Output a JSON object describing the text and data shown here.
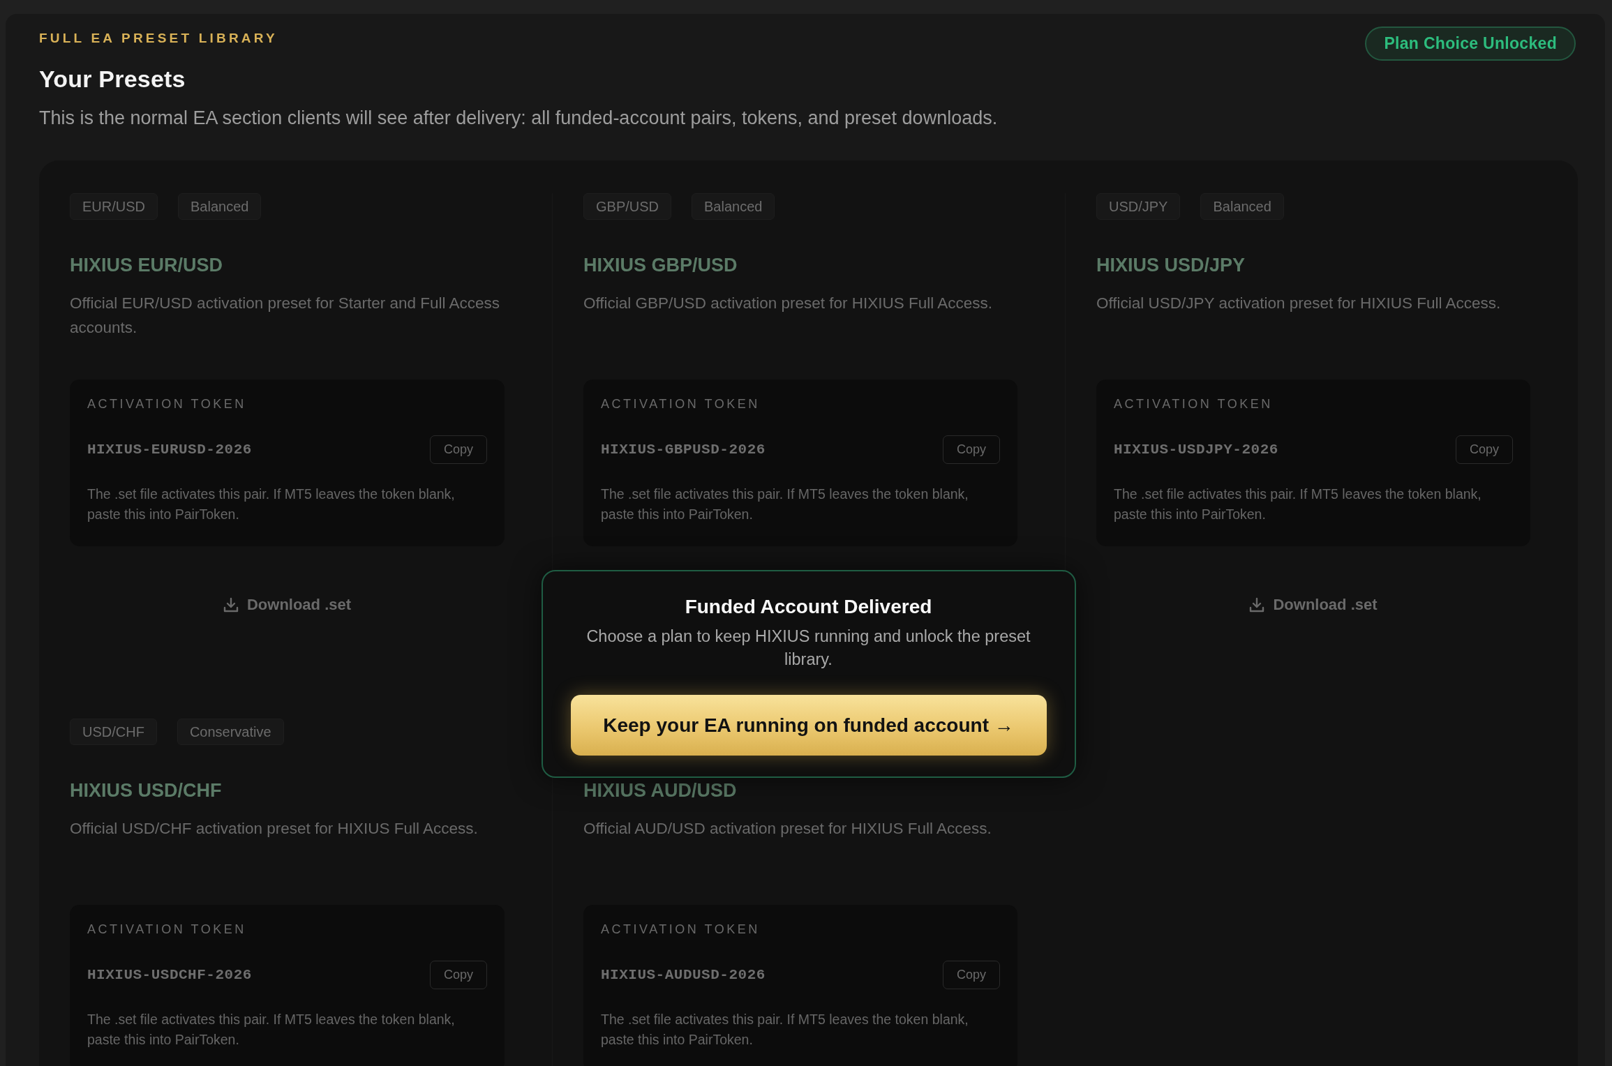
{
  "header": {
    "eyebrow": "FULL EA PRESET LIBRARY",
    "title": "Your Presets",
    "description": "This is the normal EA section clients will see after delivery: all funded-account pairs, tokens, and preset downloads.",
    "badge": "Plan Choice Unlocked"
  },
  "presets": [
    {
      "tags": [
        "EUR/USD",
        "Balanced"
      ],
      "title": "HIXIUS EUR/USD",
      "description": "Official EUR/USD activation preset for Starter and Full Access accounts.",
      "token_label": "ACTIVATION TOKEN",
      "token": "HIXIUS-EURUSD-2026",
      "copy_label": "Copy",
      "note": "The .set file activates this pair. If MT5 leaves the token blank, paste this into PairToken.",
      "download": "Download .set"
    },
    {
      "tags": [
        "GBP/USD",
        "Balanced"
      ],
      "title": "HIXIUS GBP/USD",
      "description": "Official GBP/USD activation preset for HIXIUS Full Access.",
      "token_label": "ACTIVATION TOKEN",
      "token": "HIXIUS-GBPUSD-2026",
      "copy_label": "Copy",
      "note": "The .set file activates this pair. If MT5 leaves the token blank, paste this into PairToken."
    },
    {
      "tags": [
        "USD/JPY",
        "Balanced"
      ],
      "title": "HIXIUS USD/JPY",
      "description": "Official USD/JPY activation preset for HIXIUS Full Access.",
      "token_label": "ACTIVATION TOKEN",
      "token": "HIXIUS-USDJPY-2026",
      "copy_label": "Copy",
      "note": "The .set file activates this pair. If MT5 leaves the token blank, paste this into PairToken.",
      "download": "Download .set"
    },
    {
      "tags": [
        "USD/CHF",
        "Conservative"
      ],
      "title": "HIXIUS USD/CHF",
      "description": "Official USD/CHF activation preset for HIXIUS Full Access.",
      "token_label": "ACTIVATION TOKEN",
      "token": "HIXIUS-USDCHF-2026",
      "copy_label": "Copy",
      "note": "The .set file activates this pair. If MT5 leaves the token blank, paste this into PairToken."
    },
    {
      "title": "HIXIUS AUD/USD",
      "description": "Official AUD/USD activation preset for HIXIUS Full Access.",
      "token_label": "ACTIVATION TOKEN",
      "token": "HIXIUS-AUDUSD-2026",
      "copy_label": "Copy",
      "note": "The .set file activates this pair. If MT5 leaves the token blank, paste this into PairToken."
    }
  ],
  "dialog": {
    "title": "Funded Account Delivered",
    "message": "Choose a plan to keep HIXIUS running and unlock the preset library.",
    "button": "Keep your EA running on funded account →"
  }
}
